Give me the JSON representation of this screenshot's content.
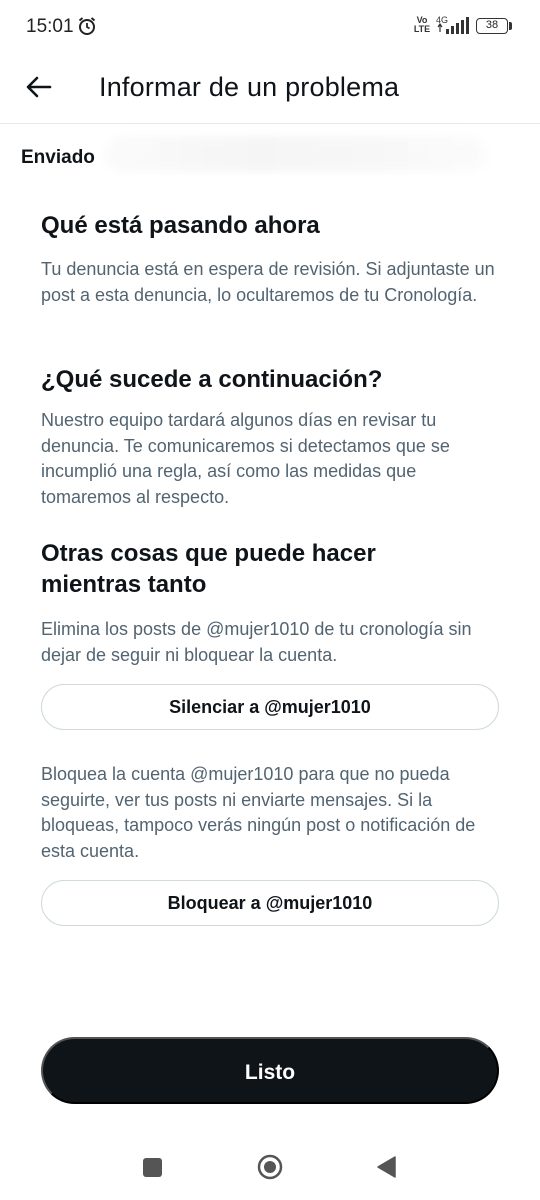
{
  "status_bar": {
    "time": "15:01",
    "network_vo": "Vo",
    "network_lte": "LTE",
    "network_4g": "4G",
    "battery": "38",
    "icons": [
      "alarm-icon",
      "signal-icon",
      "battery-icon"
    ]
  },
  "header": {
    "title": "Informar de un problema",
    "back_icon": "arrow-left-icon"
  },
  "status_label": "Enviado",
  "sections": [
    {
      "title": "Qué está pasando ahora",
      "body": "Tu denuncia está en espera de revisión. Si adjuntaste un post a esta denuncia, lo ocultaremos de tu Cronología."
    },
    {
      "title": "¿Qué sucede a continuación?",
      "body": "Nuestro equipo tardará algunos días en revisar tu denuncia. Te comunicaremos si detectamos que se incumplió una regla, así como las medidas que tomaremos al respecto."
    },
    {
      "title": "Otras cosas que puede hacer mientras tanto",
      "body": "Elimina los posts de @mujer1010 de tu cronología sin dejar de seguir ni bloquear la cuenta."
    }
  ],
  "mute_button": "Silenciar a @mujer1010",
  "block_text": "Bloquea la cuenta @mujer1010 para que no pueda seguirte, ver tus posts ni enviarte mensajes. Si la bloqueas, tampoco verás ningún post o notificación de esta cuenta.",
  "block_button": "Bloquear a @mujer1010",
  "done_button": "Listo",
  "colors": {
    "text_primary": "#0f1419",
    "text_secondary": "#536471",
    "button_dark": "#0f1419",
    "border": "#cfd9de"
  }
}
